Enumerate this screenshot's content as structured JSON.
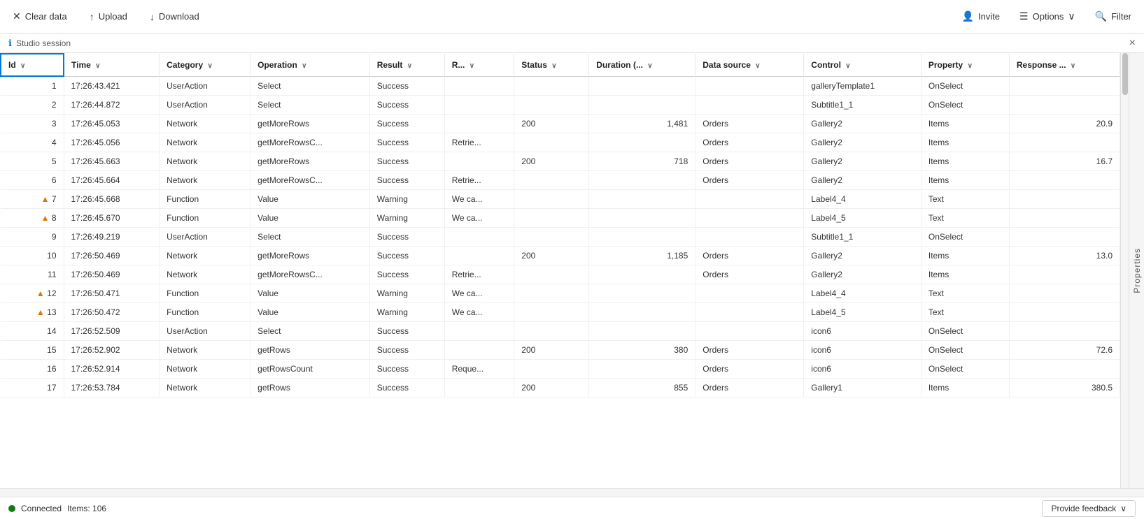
{
  "toolbar": {
    "clear_data_label": "Clear data",
    "upload_label": "Upload",
    "download_label": "Download",
    "invite_label": "Invite",
    "options_label": "Options",
    "filter_label": "Filter"
  },
  "session_bar": {
    "title": "Studio session",
    "close_label": "×"
  },
  "side_panel": {
    "label": "Properties"
  },
  "table": {
    "columns": [
      {
        "key": "id",
        "label": "Id",
        "sortable": true
      },
      {
        "key": "time",
        "label": "Time",
        "sortable": true
      },
      {
        "key": "category",
        "label": "Category",
        "sortable": true
      },
      {
        "key": "operation",
        "label": "Operation",
        "sortable": true
      },
      {
        "key": "result",
        "label": "Result",
        "sortable": true
      },
      {
        "key": "r",
        "label": "R...",
        "sortable": true
      },
      {
        "key": "status",
        "label": "Status",
        "sortable": true
      },
      {
        "key": "duration",
        "label": "Duration (..",
        "sortable": true
      },
      {
        "key": "datasource",
        "label": "Data source",
        "sortable": true
      },
      {
        "key": "control",
        "label": "Control",
        "sortable": true
      },
      {
        "key": "property",
        "label": "Property",
        "sortable": true
      },
      {
        "key": "response",
        "label": "Response ...",
        "sortable": true
      }
    ],
    "rows": [
      {
        "id": 1,
        "time": "17:26:43.421",
        "category": "UserAction",
        "operation": "Select",
        "result": "Success",
        "r": "",
        "status": "",
        "duration": "",
        "datasource": "",
        "control": "galleryTemplate1",
        "property": "OnSelect",
        "response": "",
        "warn": false
      },
      {
        "id": 2,
        "time": "17:26:44.872",
        "category": "UserAction",
        "operation": "Select",
        "result": "Success",
        "r": "",
        "status": "",
        "duration": "",
        "datasource": "",
        "control": "Subtitle1_1",
        "property": "OnSelect",
        "response": "",
        "warn": false
      },
      {
        "id": 3,
        "time": "17:26:45.053",
        "category": "Network",
        "operation": "getMoreRows",
        "result": "Success",
        "r": "",
        "status": "200",
        "duration": "1,481",
        "datasource": "Orders",
        "control": "Gallery2",
        "property": "Items",
        "response": "20.9",
        "warn": false
      },
      {
        "id": 4,
        "time": "17:26:45.056",
        "category": "Network",
        "operation": "getMoreRowsC...",
        "result": "Success",
        "r": "Retrie...",
        "status": "",
        "duration": "",
        "datasource": "Orders",
        "control": "Gallery2",
        "property": "Items",
        "response": "",
        "warn": false
      },
      {
        "id": 5,
        "time": "17:26:45.663",
        "category": "Network",
        "operation": "getMoreRows",
        "result": "Success",
        "r": "",
        "status": "200",
        "duration": "718",
        "datasource": "Orders",
        "control": "Gallery2",
        "property": "Items",
        "response": "16.7",
        "warn": false
      },
      {
        "id": 6,
        "time": "17:26:45.664",
        "category": "Network",
        "operation": "getMoreRowsC...",
        "result": "Success",
        "r": "Retrie...",
        "status": "",
        "duration": "",
        "datasource": "Orders",
        "control": "Gallery2",
        "property": "Items",
        "response": "",
        "warn": false
      },
      {
        "id": 7,
        "time": "17:26:45.668",
        "category": "Function",
        "operation": "Value",
        "result": "Warning",
        "r": "We ca...",
        "status": "",
        "duration": "",
        "datasource": "",
        "control": "Label4_4",
        "property": "Text",
        "response": "",
        "warn": true
      },
      {
        "id": 8,
        "time": "17:26:45.670",
        "category": "Function",
        "operation": "Value",
        "result": "Warning",
        "r": "We ca...",
        "status": "",
        "duration": "",
        "datasource": "",
        "control": "Label4_5",
        "property": "Text",
        "response": "",
        "warn": true
      },
      {
        "id": 9,
        "time": "17:26:49.219",
        "category": "UserAction",
        "operation": "Select",
        "result": "Success",
        "r": "",
        "status": "",
        "duration": "",
        "datasource": "",
        "control": "Subtitle1_1",
        "property": "OnSelect",
        "response": "",
        "warn": false
      },
      {
        "id": 10,
        "time": "17:26:50.469",
        "category": "Network",
        "operation": "getMoreRows",
        "result": "Success",
        "r": "",
        "status": "200",
        "duration": "1,185",
        "datasource": "Orders",
        "control": "Gallery2",
        "property": "Items",
        "response": "13.0",
        "warn": false
      },
      {
        "id": 11,
        "time": "17:26:50.469",
        "category": "Network",
        "operation": "getMoreRowsC...",
        "result": "Success",
        "r": "Retrie...",
        "status": "",
        "duration": "",
        "datasource": "Orders",
        "control": "Gallery2",
        "property": "Items",
        "response": "",
        "warn": false
      },
      {
        "id": 12,
        "time": "17:26:50.471",
        "category": "Function",
        "operation": "Value",
        "result": "Warning",
        "r": "We ca...",
        "status": "",
        "duration": "",
        "datasource": "",
        "control": "Label4_4",
        "property": "Text",
        "response": "",
        "warn": true
      },
      {
        "id": 13,
        "time": "17:26:50.472",
        "category": "Function",
        "operation": "Value",
        "result": "Warning",
        "r": "We ca...",
        "status": "",
        "duration": "",
        "datasource": "",
        "control": "Label4_5",
        "property": "Text",
        "response": "",
        "warn": true
      },
      {
        "id": 14,
        "time": "17:26:52.509",
        "category": "UserAction",
        "operation": "Select",
        "result": "Success",
        "r": "",
        "status": "",
        "duration": "",
        "datasource": "",
        "control": "icon6",
        "property": "OnSelect",
        "response": "",
        "warn": false
      },
      {
        "id": 15,
        "time": "17:26:52.902",
        "category": "Network",
        "operation": "getRows",
        "result": "Success",
        "r": "",
        "status": "200",
        "duration": "380",
        "datasource": "Orders",
        "control": "icon6",
        "property": "OnSelect",
        "response": "72.6",
        "warn": false
      },
      {
        "id": 16,
        "time": "17:26:52.914",
        "category": "Network",
        "operation": "getRowsCount",
        "result": "Success",
        "r": "Reque...",
        "status": "",
        "duration": "",
        "datasource": "Orders",
        "control": "icon6",
        "property": "OnSelect",
        "response": "",
        "warn": false
      },
      {
        "id": 17,
        "time": "17:26:53.784",
        "category": "Network",
        "operation": "getRows",
        "result": "Success",
        "r": "",
        "status": "200",
        "duration": "855",
        "datasource": "Orders",
        "control": "Gallery1",
        "property": "Items",
        "response": "380.5",
        "warn": false
      }
    ]
  },
  "status_bar": {
    "connected_label": "Connected",
    "items_label": "Items: 106",
    "feedback_label": "Provide feedback",
    "chevron_down": "∨"
  }
}
